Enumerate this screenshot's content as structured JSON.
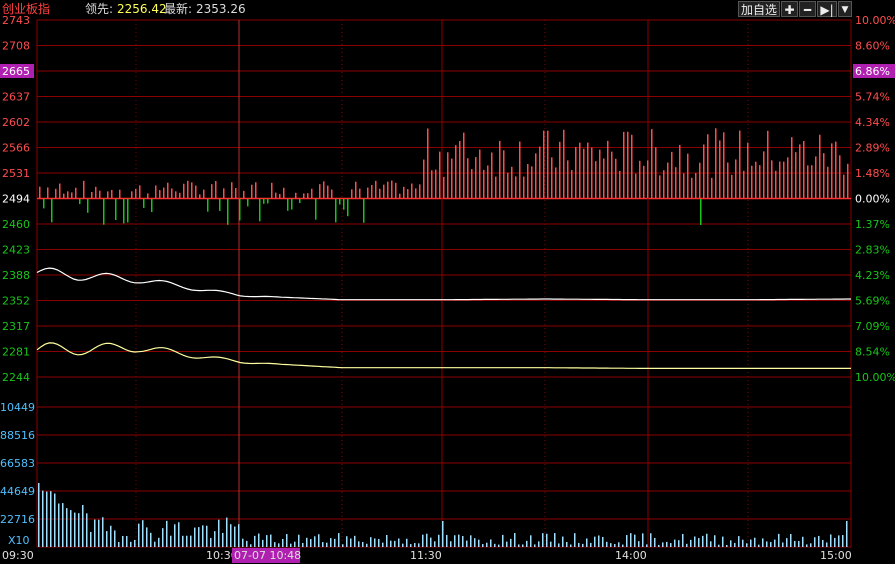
{
  "header": {
    "index_name": "创业板指",
    "lead_label": "领先:",
    "lead_value": "2256.42",
    "last_label": "最新:",
    "last_value": "2353.26",
    "add_button": "加自选",
    "plus_icon": "plus-icon",
    "minus_icon": "minus-icon",
    "jump_icon": "jump-to-end-icon",
    "menu_icon": "caret-down-icon"
  },
  "colors": {
    "background": "#000000",
    "grid": "#8b0000",
    "up": "#ff4d4d",
    "down": "#19c519",
    "main_line": "#ffffff",
    "lead_line": "#ffffa0",
    "volume": "#a0e0ff",
    "left_axis": "#ff4d4d",
    "highlight": "#b020b0"
  },
  "price_axis": {
    "left_labels": [
      "2743",
      "2708",
      "2665",
      "2637",
      "2602",
      "2566",
      "2531",
      "2494",
      "2460",
      "2423",
      "2388",
      "2352",
      "2317",
      "2281",
      "2244"
    ],
    "right_labels": [
      "10.00%",
      "8.60%",
      "6.86%",
      "5.74%",
      "4.34%",
      "2.89%",
      "1.48%",
      "0.00%",
      "1.37%",
      "2.83%",
      "4.23%",
      "5.69%",
      "7.09%",
      "8.54%",
      "10.00%"
    ],
    "highlight_left": "2665",
    "highlight_right": "6.86%",
    "base_value": "2494"
  },
  "volume_axis": {
    "labels": [
      "10449",
      "88516",
      "66583",
      "44649",
      "22716"
    ],
    "multiplier": "X10"
  },
  "time_axis": {
    "labels": [
      "09:30",
      "10:30",
      "11:30",
      "14:00",
      "15:00"
    ],
    "cursor_label": "07-07 10:48"
  },
  "chart_data": {
    "type": "line",
    "x": [
      "09:30",
      "10:00",
      "10:30",
      "11:00",
      "11:30",
      "13:30",
      "14:00",
      "14:30",
      "15:00"
    ],
    "series": [
      {
        "name": "最新",
        "values": [
          2390,
          2380,
          2358,
          2352,
          2352,
          2353,
          2352,
          2352,
          2353
        ]
      },
      {
        "name": "领先",
        "values": [
          2282,
          2285,
          2265,
          2257,
          2257,
          2257,
          2256,
          2256,
          2256
        ]
      }
    ],
    "ylim": [
      2244,
      2743
    ],
    "base": 2494,
    "grid": true
  }
}
